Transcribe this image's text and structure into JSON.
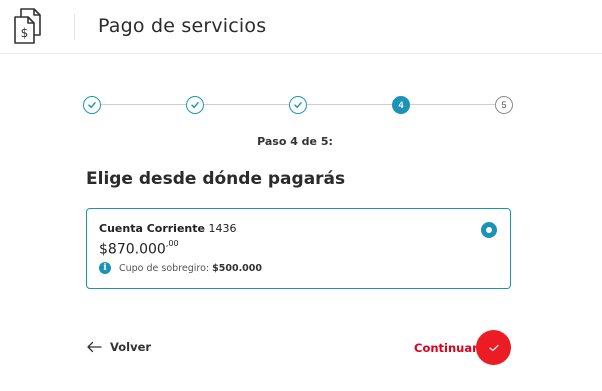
{
  "header": {
    "title": "Pago de servicios",
    "logo_icon": "document-dollar-icon"
  },
  "stepper": {
    "steps": [
      {
        "number": "1",
        "state": "done"
      },
      {
        "number": "2",
        "state": "done"
      },
      {
        "number": "3",
        "state": "done"
      },
      {
        "number": "4",
        "state": "current"
      },
      {
        "number": "5",
        "state": "pending"
      }
    ],
    "label": "Paso 4 de 5:"
  },
  "main": {
    "title": "Elige desde dónde pagarás"
  },
  "account": {
    "name": "Cuenta Corriente",
    "number": "1436",
    "balance_main": "$870.000",
    "balance_cents": ",00",
    "overdraft_label": "Cupo de sobregiro:",
    "overdraft_value": "$500.000",
    "selected": true
  },
  "actions": {
    "back_label": "Volver",
    "continue_label": "Continuar"
  },
  "colors": {
    "accent": "#1a93b6",
    "brand_red": "#ec1c24"
  }
}
